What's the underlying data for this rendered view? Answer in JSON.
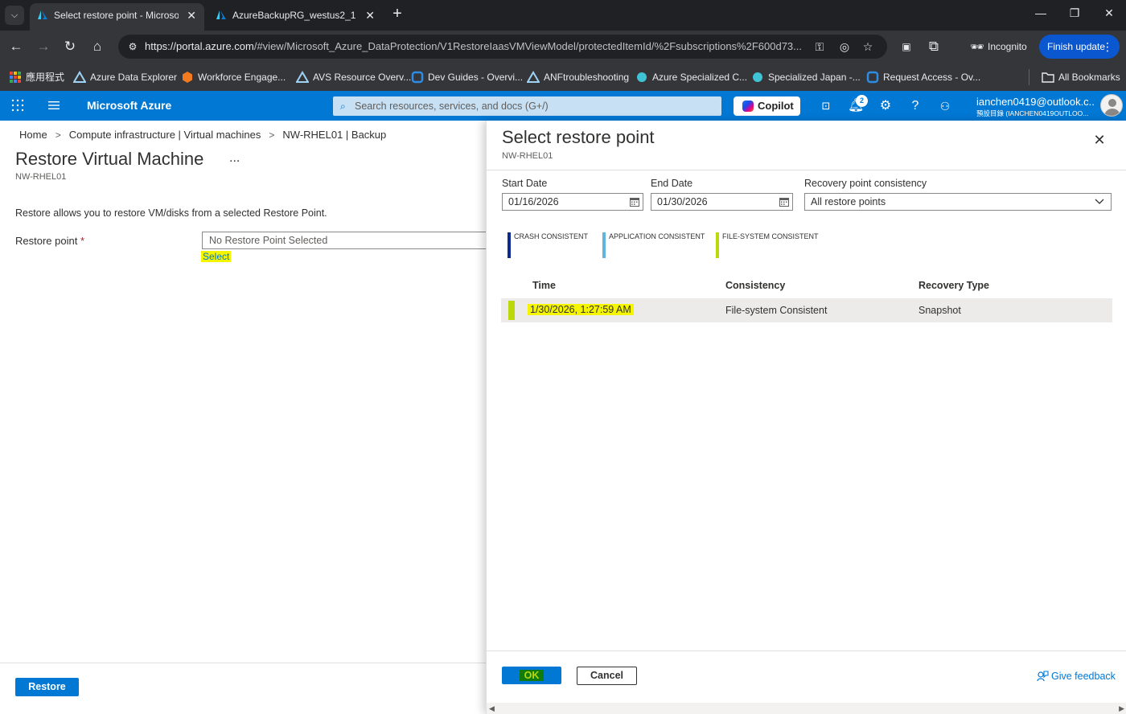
{
  "browser": {
    "tabs": [
      {
        "title": "Select restore point - Microsoft Azure",
        "active": true
      },
      {
        "title": "AzureBackupRG_westus2_1 - Microsoft Azure",
        "active": false
      }
    ],
    "url_host": "https://portal.azure.com",
    "url_rest": "/#view/Microsoft_Azure_DataProtection/V1RestoreIaasVMViewModel/protectedItemId/%2Fsubscriptions%2F600d73...",
    "incognito_label": "Incognito",
    "finish_update_label": "Finish update",
    "bookmarks": [
      "應用程式",
      "Azure Data Explorer",
      "Workforce Engage...",
      "AVS Resource Overv...",
      "Dev Guides - Overvi...",
      "ANFtroubleshooting",
      "Azure Specialized C...",
      "Specialized Japan -...",
      "Request Access - Ov..."
    ],
    "all_bookmarks_label": "All Bookmarks"
  },
  "portal": {
    "brand": "Microsoft Azure",
    "search_placeholder": "Search resources, services, and docs (G+/)",
    "copilot_label": "Copilot",
    "notification_count": "2",
    "account_email": "ianchen0419@outlook.c...",
    "account_tenant": "預設目錄 (IANCHEN0419OUTLOO..."
  },
  "blade": {
    "breadcrumb": [
      "Home",
      "Compute infrastructure | Virtual machines",
      "NW-RHEL01 | Backup"
    ],
    "title": "Restore Virtual Machine",
    "more": "...",
    "subtitle": "NW-RHEL01",
    "description": "Restore allows you to restore VM/disks from a selected Restore Point.",
    "restore_point_label": "Restore point",
    "required_mark": "*",
    "restore_point_value": "No Restore Point Selected",
    "select_link": "Select",
    "restore_button": "Restore"
  },
  "pane": {
    "title": "Select restore point",
    "subtitle": "NW-RHEL01",
    "start_date_label": "Start Date",
    "start_date": "01/16/2026",
    "end_date_label": "End Date",
    "end_date": "01/30/2026",
    "consistency_label": "Recovery point consistency",
    "consistency_value": "All restore points",
    "legend": [
      {
        "label": "CRASH CONSISTENT",
        "color": "#0c2a8f"
      },
      {
        "label": "APPLICATION CONSISTENT",
        "color": "#5fb5dc"
      },
      {
        "label": "FILE-SYSTEM CONSISTENT",
        "color": "#bad80a"
      }
    ],
    "columns": [
      "Time",
      "Consistency",
      "Recovery Type"
    ],
    "rows": [
      {
        "time": "1/30/2026, 1:27:59 AM",
        "consistency": "File-system Consistent",
        "recovery_type": "Snapshot"
      }
    ],
    "ok_button": "OK",
    "cancel_button": "Cancel",
    "feedback_link": "Give feedback"
  },
  "colors": {
    "azure_blue": "#0078d4",
    "highlight_yellow": "#f5f500",
    "browser_dark": "#202124"
  }
}
